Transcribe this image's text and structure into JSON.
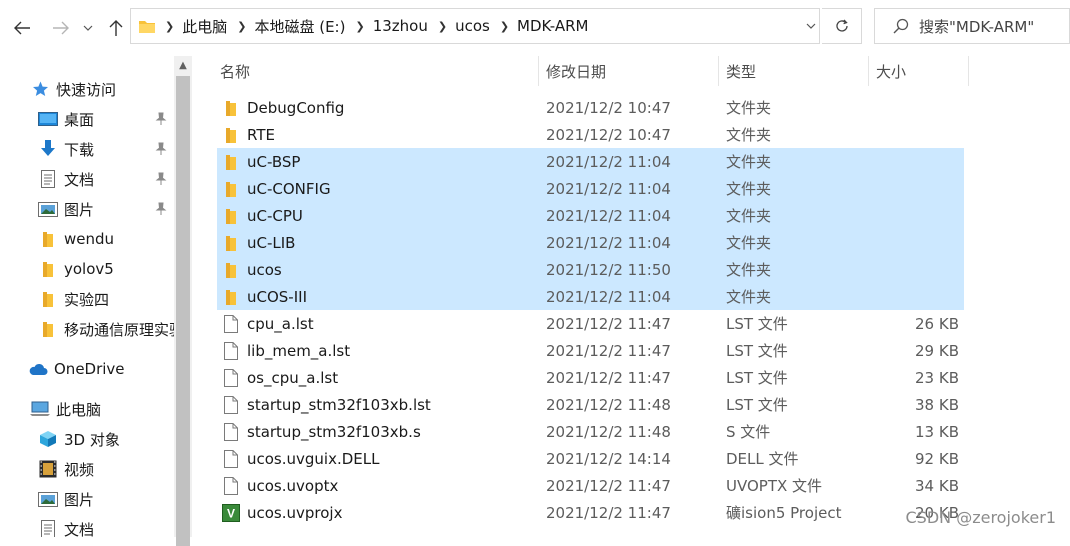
{
  "window": {
    "colors": {
      "selection": "#cce8ff",
      "folder": "#f8c23a",
      "accent": "#1a73d0"
    }
  },
  "toolbar": {
    "back_icon": "arrow-left-icon",
    "forward_icon": "arrow-right-icon",
    "history_icon": "chevron-down-icon",
    "up_icon": "arrow-up-icon"
  },
  "address": {
    "crumbs": [
      "此电脑",
      "本地磁盘 (E:)",
      "13zhou",
      "ucos",
      "MDK-ARM"
    ]
  },
  "search": {
    "placeholder": "搜索\"MDK-ARM\""
  },
  "sidebar": {
    "items": [
      {
        "label": "快速访问",
        "icon": "star-icon",
        "pinned": false
      },
      {
        "label": "桌面",
        "icon": "desktop-icon",
        "pinned": true
      },
      {
        "label": "下载",
        "icon": "download-icon",
        "pinned": true
      },
      {
        "label": "文档",
        "icon": "document-icon",
        "pinned": true
      },
      {
        "label": "图片",
        "icon": "picture-icon",
        "pinned": true
      },
      {
        "label": "wendu",
        "icon": "folder-icon",
        "pinned": false
      },
      {
        "label": "yolov5",
        "icon": "folder-icon",
        "pinned": false
      },
      {
        "label": "实验四",
        "icon": "folder-icon",
        "pinned": false
      },
      {
        "label": "移动通信原理实验",
        "icon": "folder-icon",
        "pinned": false
      },
      {
        "label": "OneDrive",
        "icon": "cloud-icon",
        "pinned": false
      },
      {
        "label": "此电脑",
        "icon": "computer-icon",
        "pinned": false
      },
      {
        "label": "3D 对象",
        "icon": "cube-icon",
        "pinned": false
      },
      {
        "label": "视频",
        "icon": "film-icon",
        "pinned": false
      },
      {
        "label": "图片",
        "icon": "picture-icon",
        "pinned": false
      },
      {
        "label": "文档",
        "icon": "document-icon",
        "pinned": false
      }
    ]
  },
  "columns": {
    "name": "名称",
    "date": "修改日期",
    "type": "类型",
    "size": "大小"
  },
  "files": [
    {
      "name": "DebugConfig",
      "date": "2021/12/2 10:47",
      "type": "文件夹",
      "size": "",
      "icon": "folder-icon",
      "selected": false
    },
    {
      "name": "RTE",
      "date": "2021/12/2 10:47",
      "type": "文件夹",
      "size": "",
      "icon": "folder-icon",
      "selected": false
    },
    {
      "name": "uC-BSP",
      "date": "2021/12/2 11:04",
      "type": "文件夹",
      "size": "",
      "icon": "folder-icon",
      "selected": true
    },
    {
      "name": "uC-CONFIG",
      "date": "2021/12/2 11:04",
      "type": "文件夹",
      "size": "",
      "icon": "folder-icon",
      "selected": true
    },
    {
      "name": "uC-CPU",
      "date": "2021/12/2 11:04",
      "type": "文件夹",
      "size": "",
      "icon": "folder-icon",
      "selected": true
    },
    {
      "name": "uC-LIB",
      "date": "2021/12/2 11:04",
      "type": "文件夹",
      "size": "",
      "icon": "folder-icon",
      "selected": true
    },
    {
      "name": "ucos",
      "date": "2021/12/2 11:50",
      "type": "文件夹",
      "size": "",
      "icon": "folder-icon",
      "selected": true
    },
    {
      "name": "uCOS-III",
      "date": "2021/12/2 11:04",
      "type": "文件夹",
      "size": "",
      "icon": "folder-icon",
      "selected": true
    },
    {
      "name": "cpu_a.lst",
      "date": "2021/12/2 11:47",
      "type": "LST 文件",
      "size": "26 KB",
      "icon": "file-icon",
      "selected": false
    },
    {
      "name": "lib_mem_a.lst",
      "date": "2021/12/2 11:47",
      "type": "LST 文件",
      "size": "29 KB",
      "icon": "file-icon",
      "selected": false
    },
    {
      "name": "os_cpu_a.lst",
      "date": "2021/12/2 11:47",
      "type": "LST 文件",
      "size": "23 KB",
      "icon": "file-icon",
      "selected": false
    },
    {
      "name": "startup_stm32f103xb.lst",
      "date": "2021/12/2 11:48",
      "type": "LST 文件",
      "size": "38 KB",
      "icon": "file-icon",
      "selected": false
    },
    {
      "name": "startup_stm32f103xb.s",
      "date": "2021/12/2 11:48",
      "type": "S 文件",
      "size": "13 KB",
      "icon": "file-icon",
      "selected": false
    },
    {
      "name": "ucos.uvguix.DELL",
      "date": "2021/12/2 14:14",
      "type": "DELL 文件",
      "size": "92 KB",
      "icon": "file-icon",
      "selected": false
    },
    {
      "name": "ucos.uvoptx",
      "date": "2021/12/2 11:47",
      "type": "UVOPTX 文件",
      "size": "34 KB",
      "icon": "file-icon",
      "selected": false
    },
    {
      "name": "ucos.uvprojx",
      "date": "2021/12/2 11:47",
      "type": "礦ision5 Project",
      "size": "20 KB",
      "icon": "keil-project-icon",
      "selected": false
    }
  ],
  "watermark": "CSDN @zerojoker1"
}
